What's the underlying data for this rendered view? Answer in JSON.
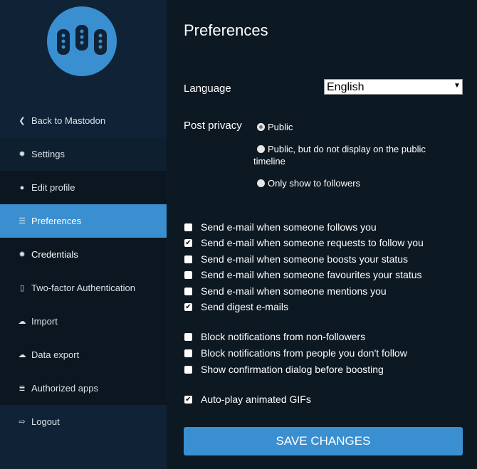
{
  "sidebar": {
    "items": [
      {
        "label": "Back to Mastodon",
        "icon": "chevron-left-icon"
      },
      {
        "label": "Settings",
        "icon": "gear-icon"
      },
      {
        "label": "Edit profile",
        "icon": "user-icon"
      },
      {
        "label": "Preferences",
        "icon": "sliders-icon",
        "active": true
      },
      {
        "label": "Credentials",
        "icon": "gear-icon"
      },
      {
        "label": "Two-factor Authentication",
        "icon": "mobile-icon"
      },
      {
        "label": "Import",
        "icon": "cloud-upload-icon"
      },
      {
        "label": "Data export",
        "icon": "cloud-download-icon"
      },
      {
        "label": "Authorized apps",
        "icon": "list-icon"
      },
      {
        "label": "Logout",
        "icon": "sign-out-icon"
      }
    ]
  },
  "main": {
    "title": "Preferences",
    "language_label": "Language",
    "language_value": "English",
    "privacy_label": "Post privacy",
    "privacy_options": [
      "Public",
      "Public, but do not display on the public timeline",
      "Only show to followers"
    ],
    "privacy_selected": "Public",
    "checkboxes": [
      {
        "label": "Send e-mail when someone follows you",
        "checked": false
      },
      {
        "label": "Send e-mail when someone requests to follow you",
        "checked": true
      },
      {
        "label": "Send e-mail when someone boosts your status",
        "checked": false
      },
      {
        "label": "Send e-mail when someone favourites your status",
        "checked": false
      },
      {
        "label": "Send e-mail when someone mentions you",
        "checked": false
      },
      {
        "label": "Send digest e-mails",
        "checked": true
      },
      {
        "label": "Block notifications from non-followers",
        "checked": false
      },
      {
        "label": "Block notifications from people you don't follow",
        "checked": false
      },
      {
        "label": "Show confirmation dialog before boosting",
        "checked": false
      },
      {
        "label": "Auto-play animated GIFs",
        "checked": true
      }
    ],
    "save_label": "SAVE CHANGES"
  },
  "colors": {
    "accent": "#3a8fd0",
    "sidebar": "#102336",
    "main": "#0c1822"
  }
}
